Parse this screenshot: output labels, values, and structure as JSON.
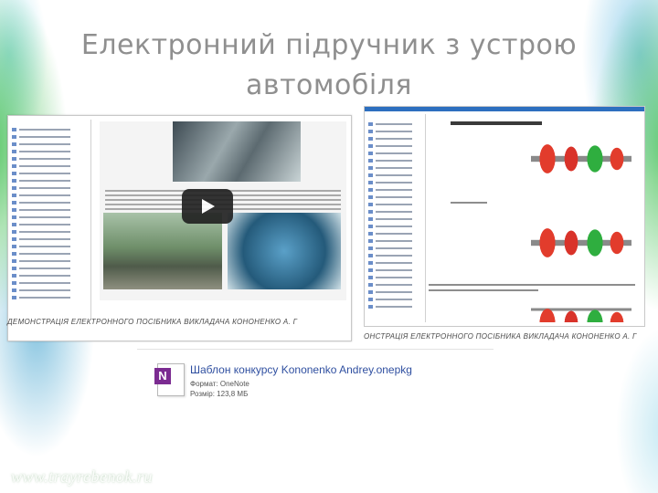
{
  "slide": {
    "title_line1": "Електронний підручник з устрою",
    "title_line2": "автомобіля"
  },
  "left_screenshot": {
    "caption": "ДЕМОНСТРАЦІЯ ЕЛЕКТРОННОГО ПОСІБНИКА ВИКЛАДАЧА КОНОНЕНКО А. Г"
  },
  "right_screenshot": {
    "caption": "ОНСТРАЦІЯ ЕЛЕКТРОННОГО ПОСІБНИКА ВИКЛАДАЧА КОНОНЕНКО А. Г"
  },
  "file": {
    "icon_letter": "N",
    "name": "Шаблон конкурсу Kononenko Andrey.onepkg",
    "format": "Формат: OneNote",
    "size": "Розмір: 123,8 МБ"
  },
  "watermark": "www.trayrebenok.ru",
  "colors": {
    "title": "#8f8f8f",
    "file_name": "#2f4fa0",
    "onenote_purple": "#7b2b91",
    "swirl_green": "#40be50",
    "swirl_blue": "#2896c8"
  }
}
